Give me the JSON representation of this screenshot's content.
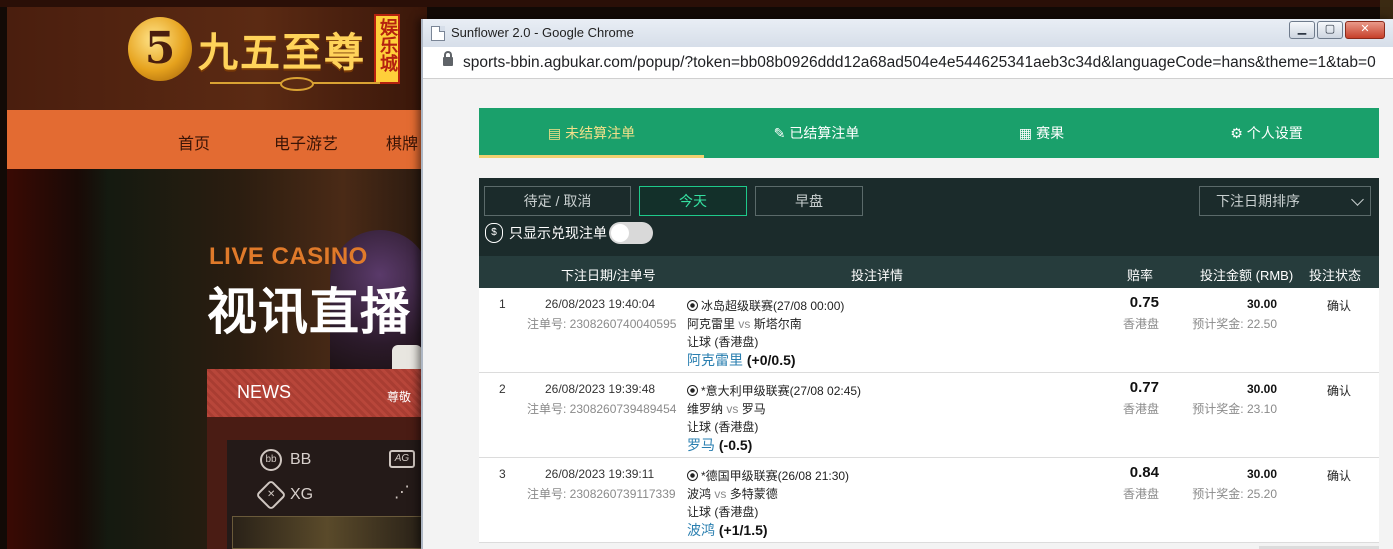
{
  "background": {
    "logo": {
      "badge": "5",
      "text": "九五至尊",
      "side": "娱乐城"
    },
    "nav": [
      "首页",
      "电子游艺",
      "棋牌"
    ],
    "hero": {
      "tag": "LIVE CASINO",
      "title": "视讯直播"
    },
    "news": {
      "label": "NEWS",
      "more": "尊敬"
    },
    "games": [
      {
        "icon": "bb",
        "label": "BB"
      },
      {
        "icon": "AG",
        "label": ""
      },
      {
        "icon": "✕",
        "label": "XG"
      },
      {
        "icon": "⋰",
        "label": ""
      }
    ],
    "colors": {
      "nav": "#e36b32",
      "header": "#5b2a13",
      "gold": "#ffd35a"
    }
  },
  "window": {
    "title": "Sunflower 2.0 - Google Chrome",
    "controls": {
      "minimize": "▁",
      "maximize": "▢",
      "close": "✕"
    },
    "url": "sports-bbin.agbukar.com/popup/?token=bb08b0926ddd12a68ad504e4e544625341aeb3c34d&languageCode=hans&theme=1&tab=0"
  },
  "tabs": [
    {
      "icon": "unsettled-icon",
      "glyph": "▤",
      "label": "未结算注单",
      "active": true
    },
    {
      "icon": "settled-icon",
      "glyph": "✎",
      "label": "已结算注单",
      "active": false
    },
    {
      "icon": "results-icon",
      "glyph": "▦",
      "label": "赛果",
      "active": false
    },
    {
      "icon": "settings-icon",
      "glyph": "⚙",
      "label": "个人设置",
      "active": false
    }
  ],
  "filters": {
    "buttons": [
      "待定 / 取消",
      "今天",
      "早盘"
    ],
    "active_index": 1,
    "sort": "下注日期排序",
    "cashout_label": "只显示兑现注单",
    "cashout_enabled": false
  },
  "table": {
    "headers": {
      "date": "下注日期/注单号",
      "detail": "投注详情",
      "odds": "赔率",
      "stake": "投注金额 (RMB)",
      "status": "投注状态"
    },
    "rows": [
      {
        "num": "1",
        "date": "26/08/2023 19:40:04",
        "bet_id": "注单号: 2308260740040595",
        "league": "冰岛超级联赛(27/08 00:00)",
        "home": "阿克雷里",
        "vs": "vs",
        "away": "斯塔尔南",
        "market": "让球 (香港盘)",
        "pick_team": "阿克雷里",
        "pick_line": "(+0/0.5)",
        "odds": "0.75",
        "odds_type": "香港盘",
        "stake": "30.00",
        "est_win": "预计奖金: 22.50",
        "status": "确认"
      },
      {
        "num": "2",
        "date": "26/08/2023 19:39:48",
        "bet_id": "注单号: 2308260739489454",
        "league": "*意大利甲级联赛(27/08 02:45)",
        "home": "维罗纳",
        "vs": "vs",
        "away": "罗马",
        "market": "让球 (香港盘)",
        "pick_team": "罗马",
        "pick_line": "(-0.5)",
        "odds": "0.77",
        "odds_type": "香港盘",
        "stake": "30.00",
        "est_win": "预计奖金: 23.10",
        "status": "确认"
      },
      {
        "num": "3",
        "date": "26/08/2023 19:39:11",
        "bet_id": "注单号: 2308260739117339",
        "league": "*德国甲级联赛(26/08 21:30)",
        "home": "波鸿",
        "vs": "vs",
        "away": "多特蒙德",
        "market": "让球 (香港盘)",
        "pick_team": "波鸿",
        "pick_line": "(+1/1.5)",
        "odds": "0.84",
        "odds_type": "香港盘",
        "stake": "30.00",
        "est_win": "预计奖金: 25.20",
        "status": "确认"
      }
    ]
  },
  "colors": {
    "accent": "#1aa06b",
    "active_tab_text": "#f3e08a",
    "panel": "#1b2b2b",
    "header": "#263c3c",
    "pick_team": "#2a7fb0",
    "active_filter": "#35e0a0"
  }
}
